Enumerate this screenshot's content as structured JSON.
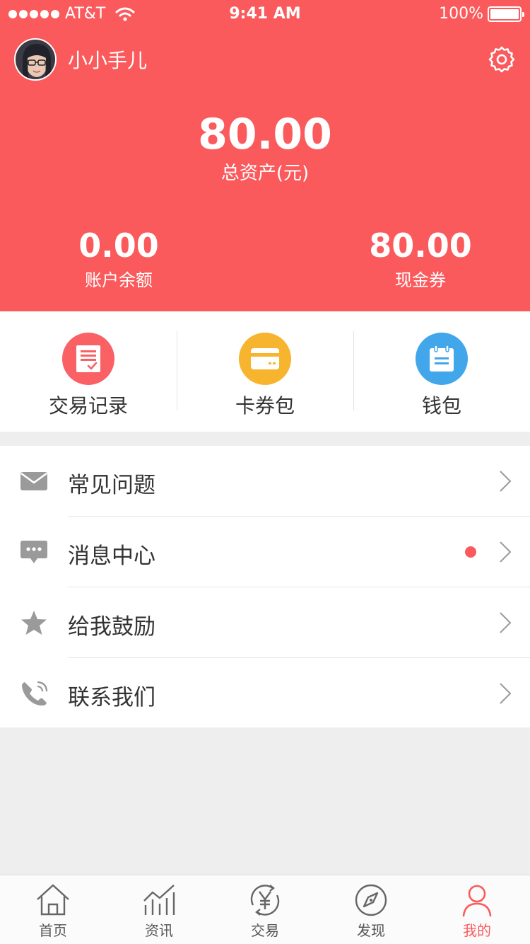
{
  "status_bar": {
    "carrier": "AT&T",
    "time": "9:41 AM",
    "battery": "100%"
  },
  "profile": {
    "username": "小小手儿"
  },
  "assets": {
    "total_value": "80.00",
    "total_label": "总资产(元)",
    "balance_value": "0.00",
    "balance_label": "账户余额",
    "coupon_value": "80.00",
    "coupon_label": "现金券"
  },
  "quick_actions": [
    {
      "label": "交易记录",
      "icon": "receipt-icon",
      "color": "#f96165"
    },
    {
      "label": "卡券包",
      "icon": "card-icon",
      "color": "#f7b52f"
    },
    {
      "label": "钱包",
      "icon": "calendar-wallet-icon",
      "color": "#42a6ea"
    }
  ],
  "menu": [
    {
      "label": "常见问题",
      "icon": "mail-icon",
      "badge": false
    },
    {
      "label": "消息中心",
      "icon": "chat-icon",
      "badge": true
    },
    {
      "label": "给我鼓励",
      "icon": "star-icon",
      "badge": false
    },
    {
      "label": "联系我们",
      "icon": "phone-icon",
      "badge": false
    }
  ],
  "tabbar": {
    "active": "我的",
    "items": [
      {
        "label": "首页",
        "icon": "home-icon"
      },
      {
        "label": "资讯",
        "icon": "chart-icon"
      },
      {
        "label": "交易",
        "icon": "yen-exchange-icon"
      },
      {
        "label": "发现",
        "icon": "compass-icon"
      },
      {
        "label": "我的",
        "icon": "user-icon"
      }
    ]
  },
  "colors": {
    "primary": "#fb5a5c",
    "background": "#eeeeee",
    "icon_gray": "#9a9a9a"
  }
}
